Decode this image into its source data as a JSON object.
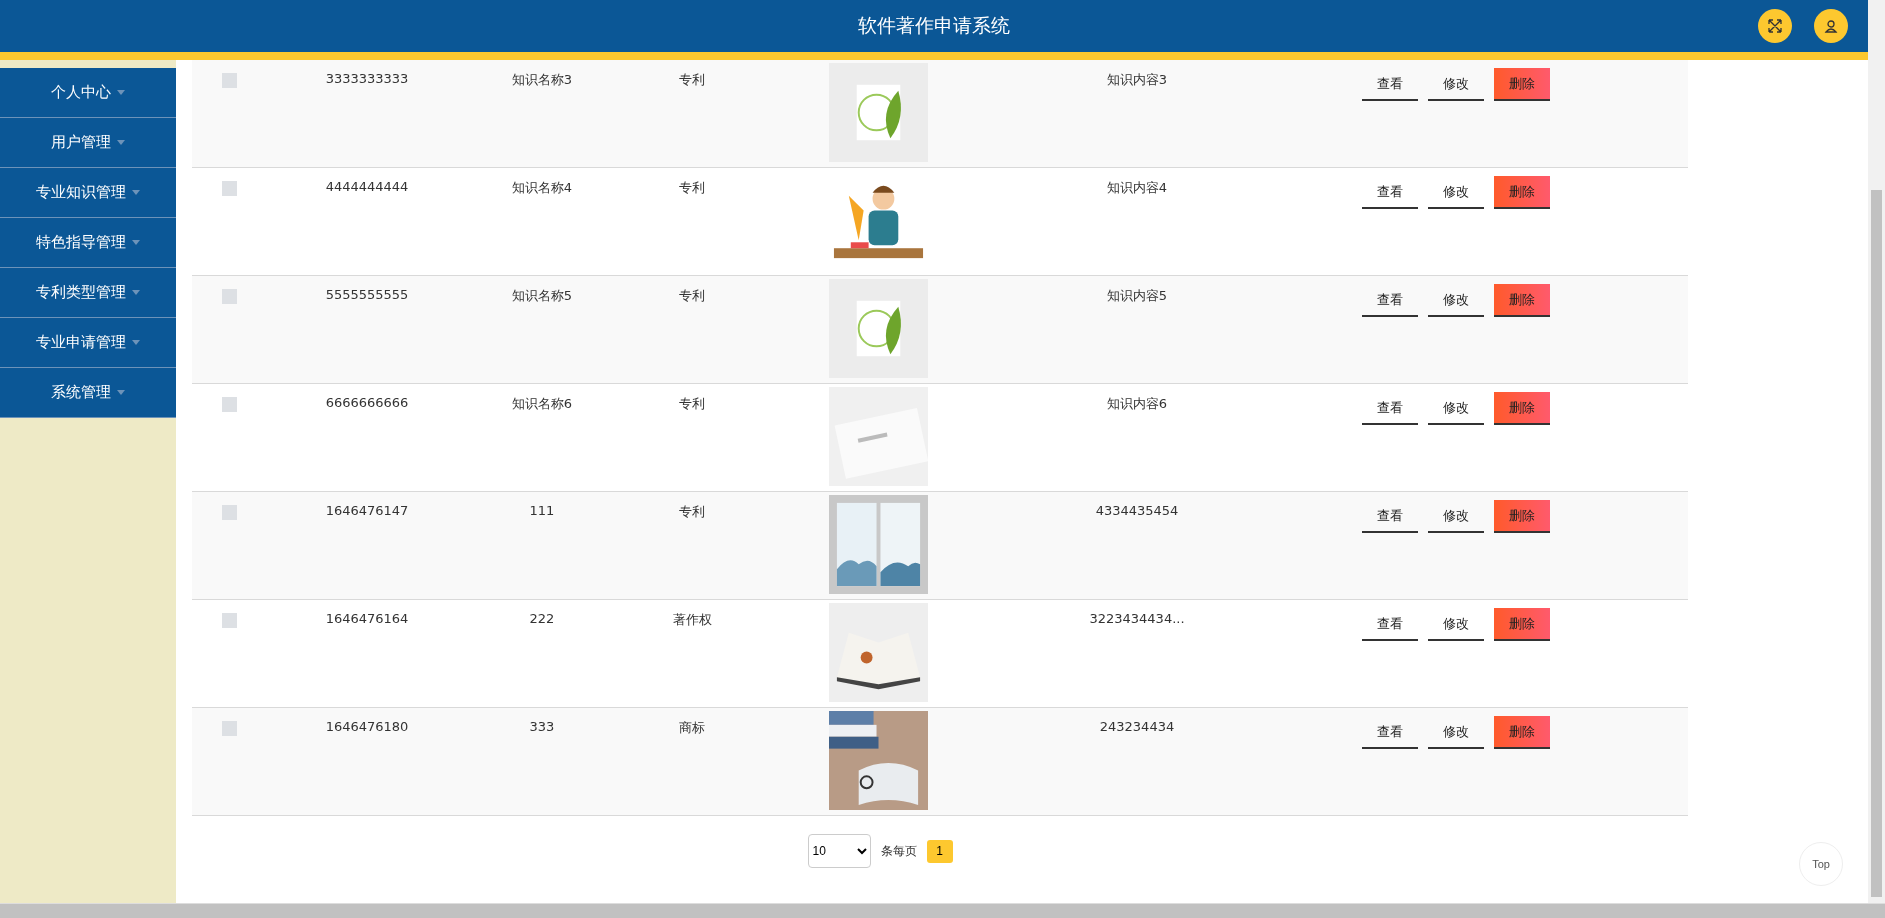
{
  "header": {
    "title": "软件著作申请系统"
  },
  "sidebar": {
    "items": [
      {
        "label": "个人中心"
      },
      {
        "label": "用户管理"
      },
      {
        "label": "专业知识管理"
      },
      {
        "label": "特色指导管理"
      },
      {
        "label": "专利类型管理"
      },
      {
        "label": "专业申请管理"
      },
      {
        "label": "系统管理"
      }
    ]
  },
  "table": {
    "rows": [
      {
        "checked": false,
        "column_1": "3333333333",
        "column_2": "知识名称3",
        "column_3": "专利",
        "column_5": "知识内容3",
        "actions": [
          "查看",
          "修改",
          "删除"
        ]
      },
      {
        "checked": false,
        "column_1": "4444444444",
        "column_2": "知识名称4",
        "column_3": "专利",
        "column_5": "知识内容4",
        "actions": [
          "查看",
          "修改",
          "删除"
        ]
      },
      {
        "checked": false,
        "column_1": "5555555555",
        "column_2": "知识名称5",
        "column_3": "专利",
        "column_5": "知识内容5",
        "actions": [
          "查看",
          "修改",
          "删除"
        ]
      },
      {
        "checked": false,
        "column_1": "6666666666",
        "column_2": "知识名称6",
        "column_3": "专利",
        "column_5": "知识内容6",
        "actions": [
          "查看",
          "修改",
          "删除"
        ]
      },
      {
        "checked": false,
        "column_1": "1646476147",
        "column_2": "111",
        "column_3": "专利",
        "column_5": "4334435454",
        "actions": [
          "查看",
          "修改",
          "删除"
        ]
      },
      {
        "checked": false,
        "column_1": "1646476164",
        "column_2": "222",
        "column_3": "著作权",
        "column_5": "3223434434...",
        "actions": [
          "查看",
          "修改",
          "删除"
        ]
      },
      {
        "checked": false,
        "column_1": "1646476180",
        "column_2": "333",
        "column_3": "商标",
        "column_5": "243234434",
        "actions": [
          "查看",
          "修改",
          "删除"
        ]
      }
    ]
  },
  "pagination": {
    "page_size": "10",
    "per_page_label": "条每页",
    "pages": [
      {
        "label": "1",
        "selected": true
      }
    ]
  },
  "top_button": "Top"
}
